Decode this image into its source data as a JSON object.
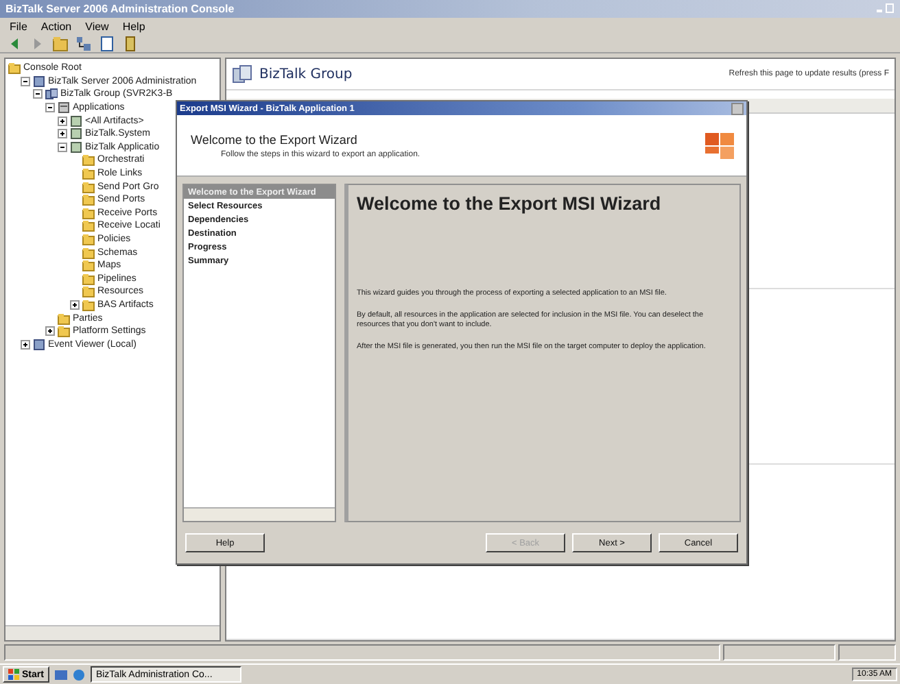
{
  "window": {
    "title": "BizTalk Server 2006 Administration Console"
  },
  "menu": [
    {
      "label": "File"
    },
    {
      "label": "Action"
    },
    {
      "label": "View"
    },
    {
      "label": "Help"
    }
  ],
  "toolbar": [
    {
      "kind": "back"
    },
    {
      "kind": "forward"
    },
    {
      "kind": "up"
    },
    {
      "kind": "tree"
    },
    {
      "kind": "export"
    },
    {
      "kind": "help"
    }
  ],
  "tree": [
    {
      "label": "Console Root",
      "kind": "folder",
      "children": [
        {
          "label": "BizTalk Server 2006 Administration",
          "kind": "server",
          "expanded": true,
          "children": [
            {
              "label": "BizTalk Group (SVR2K3-B",
              "kind": "group",
              "expanded": true,
              "children": [
                {
                  "label": "Applications",
                  "kind": "apps",
                  "expanded": true,
                  "children": [
                    {
                      "label": "<All Artifacts>",
                      "kind": "app",
                      "expanded": false
                    },
                    {
                      "label": "BizTalk.System",
                      "kind": "app",
                      "expanded": false
                    },
                    {
                      "label": "BizTalk Applicatio",
                      "kind": "app",
                      "expanded": true,
                      "children": [
                        {
                          "label": "Orchestrati",
                          "kind": "folder"
                        },
                        {
                          "label": "Role Links",
                          "kind": "folder"
                        },
                        {
                          "label": "Send Port Gro",
                          "kind": "folder"
                        },
                        {
                          "label": "Send Ports",
                          "kind": "folder"
                        },
                        {
                          "label": "Receive Ports",
                          "kind": "folder"
                        },
                        {
                          "label": "Receive Locati",
                          "kind": "folder"
                        },
                        {
                          "label": "Policies",
                          "kind": "folder"
                        },
                        {
                          "label": "Schemas",
                          "kind": "folder"
                        },
                        {
                          "label": "Maps",
                          "kind": "folder"
                        },
                        {
                          "label": "Pipelines",
                          "kind": "folder"
                        },
                        {
                          "label": "Resources",
                          "kind": "folder"
                        },
                        {
                          "label": "BAS Artifacts",
                          "kind": "folder",
                          "expanded": false
                        }
                      ]
                    }
                  ]
                },
                {
                  "label": "Parties",
                  "kind": "folder"
                },
                {
                  "label": "Platform Settings",
                  "kind": "folder",
                  "expanded": false
                }
              ]
            }
          ]
        },
        {
          "label": "Event Viewer (Local)",
          "kind": "server",
          "expanded": false
        }
      ]
    }
  ],
  "details": {
    "title": "BizTalk Group",
    "hint": "Refresh this page to update results (press F"
  },
  "wizard": {
    "title": "Export MSI Wizard - BizTalk Application 1",
    "header": {
      "title": "Welcome to the Export Wizard",
      "subtitle": "Follow the steps in this wizard to export an application."
    },
    "steps": [
      {
        "label": "Welcome to the Export Wizard",
        "selected": true
      },
      {
        "label": "Select Resources",
        "selected": false
      },
      {
        "label": "Dependencies",
        "selected": false
      },
      {
        "label": "Destination",
        "selected": false
      },
      {
        "label": "Progress",
        "selected": false
      },
      {
        "label": "Summary",
        "selected": false
      }
    ],
    "heading": "Welcome to the Export MSI Wizard",
    "paragraphs": [
      "This wizard guides you through the process of exporting a selected application to an MSI file.",
      "By default, all resources in the application are selected for inclusion in the MSI file. You can deselect the resources that you don't want to include.",
      "After the MSI file is generated, you then run the MSI file on the target computer to deploy the application."
    ],
    "buttons": [
      {
        "label": "Help",
        "kind": "help",
        "disabled": false
      },
      {
        "label": "< Back",
        "kind": "nav",
        "disabled": true
      },
      {
        "label": "Next >",
        "kind": "nav",
        "disabled": false
      },
      {
        "label": "Cancel",
        "kind": "nav",
        "disabled": false
      }
    ]
  },
  "taskbar": {
    "start": "Start",
    "tasks": [
      {
        "label": "BizTalk Administration Co...",
        "selected": true
      }
    ],
    "clock": "10:35 AM"
  }
}
